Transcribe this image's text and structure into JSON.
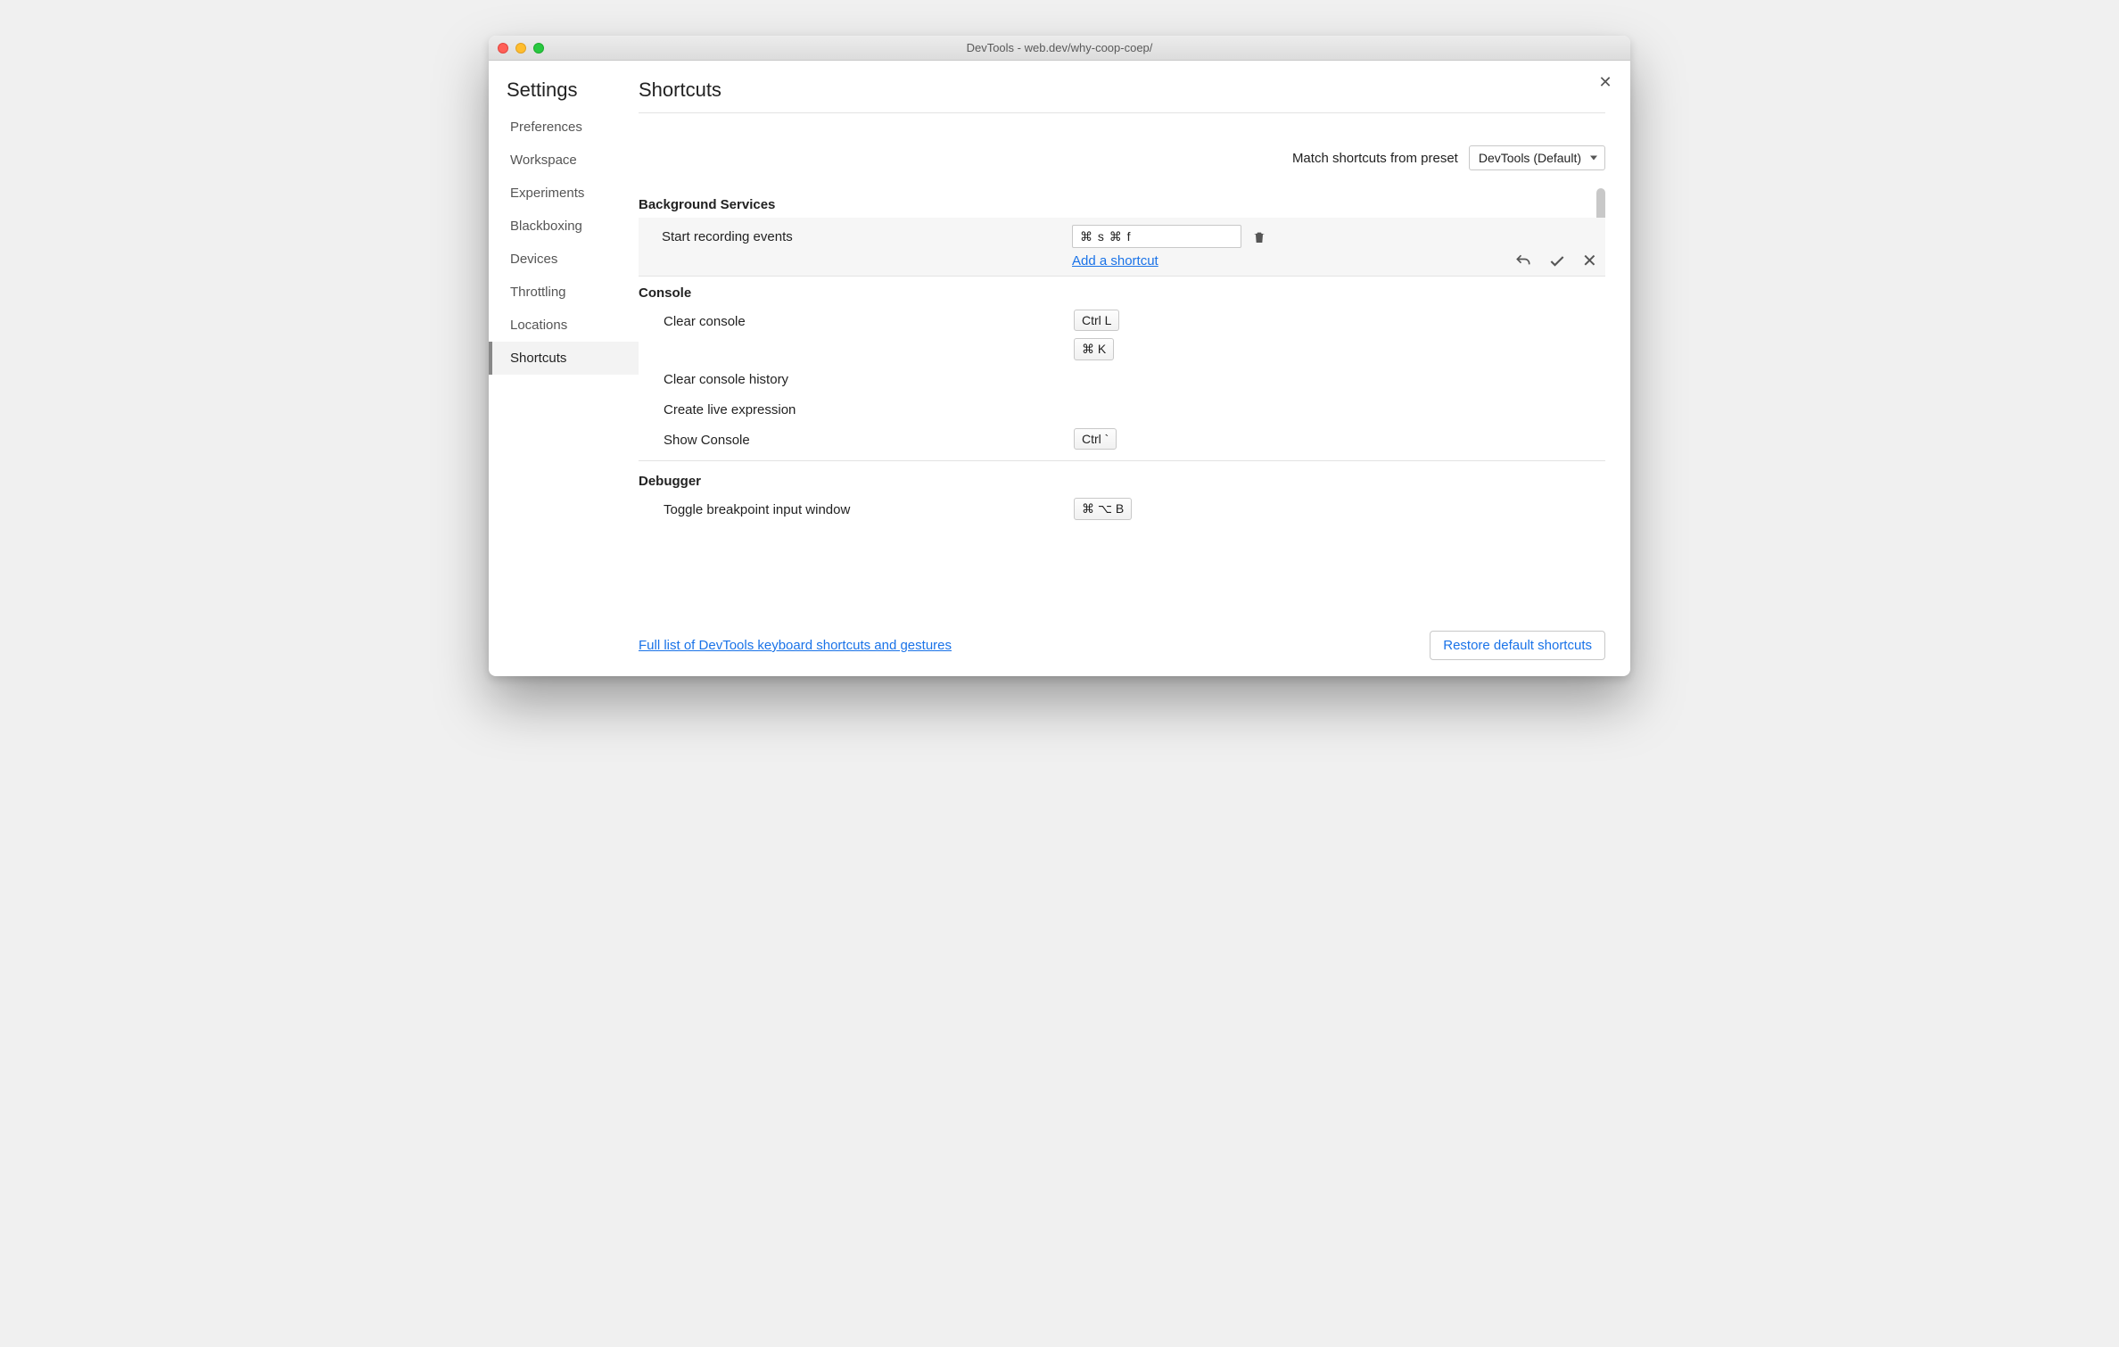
{
  "window": {
    "title": "DevTools - web.dev/why-coop-coep/"
  },
  "sidebar": {
    "heading": "Settings",
    "items": [
      {
        "label": "Preferences",
        "active": false
      },
      {
        "label": "Workspace",
        "active": false
      },
      {
        "label": "Experiments",
        "active": false
      },
      {
        "label": "Blackboxing",
        "active": false
      },
      {
        "label": "Devices",
        "active": false
      },
      {
        "label": "Throttling",
        "active": false
      },
      {
        "label": "Locations",
        "active": false
      },
      {
        "label": "Shortcuts",
        "active": true
      }
    ]
  },
  "main": {
    "heading": "Shortcuts",
    "preset_label": "Match shortcuts from preset",
    "preset_value": "DevTools (Default)",
    "sections": {
      "bg": {
        "title": "Background Services",
        "editing": {
          "label": "Start recording events",
          "input_value": "⌘ s ⌘ f",
          "add_link": "Add a shortcut"
        }
      },
      "console": {
        "title": "Console",
        "rows": {
          "clear": {
            "label": "Clear console",
            "key1": "Ctrl L",
            "key2": "⌘ K"
          },
          "history": {
            "label": "Clear console history"
          },
          "live": {
            "label": "Create live expression"
          },
          "show": {
            "label": "Show Console",
            "key1": "Ctrl `"
          }
        }
      },
      "debugger": {
        "title": "Debugger",
        "rows": {
          "toggle": {
            "label": "Toggle breakpoint input window",
            "key1": "⌘ ⌥ B"
          }
        }
      }
    },
    "footer": {
      "full_link": "Full list of DevTools keyboard shortcuts and gestures",
      "restore": "Restore default shortcuts"
    }
  }
}
